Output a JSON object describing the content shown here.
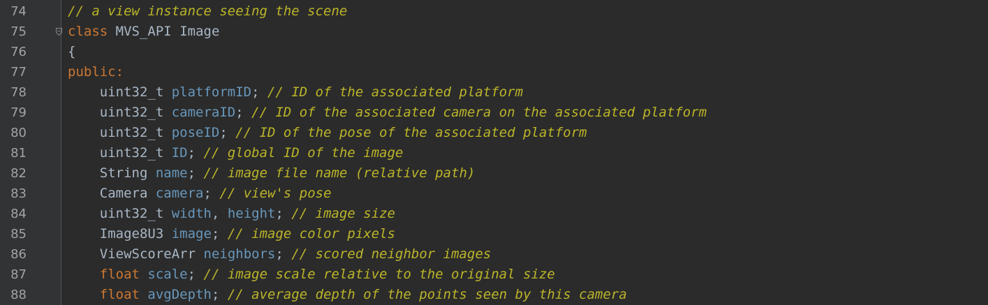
{
  "editor": {
    "lines": [
      {
        "number": "74",
        "indent": "",
        "tokens": [
          {
            "kind": "comment",
            "text": "// a view instance seeing the scene"
          }
        ]
      },
      {
        "number": "75",
        "indent": "",
        "fold": true,
        "tokens": [
          {
            "kind": "kw",
            "text": "class"
          },
          {
            "kind": "plain",
            "text": " "
          },
          {
            "kind": "api",
            "text": "MVS_API"
          },
          {
            "kind": "plain",
            "text": " "
          },
          {
            "kind": "cls",
            "text": "Image"
          }
        ]
      },
      {
        "number": "76",
        "indent": "",
        "tokens": [
          {
            "kind": "plain",
            "text": "{"
          }
        ]
      },
      {
        "number": "77",
        "indent": "",
        "tokens": [
          {
            "kind": "kw",
            "text": "public:"
          }
        ]
      },
      {
        "number": "78",
        "indent": "    ",
        "tokens": [
          {
            "kind": "type",
            "text": "uint32_t"
          },
          {
            "kind": "plain",
            "text": " "
          },
          {
            "kind": "member",
            "text": "platformID"
          },
          {
            "kind": "plain",
            "text": "; "
          },
          {
            "kind": "comment",
            "text": "// ID of the associated platform"
          }
        ]
      },
      {
        "number": "79",
        "indent": "    ",
        "tokens": [
          {
            "kind": "type",
            "text": "uint32_t"
          },
          {
            "kind": "plain",
            "text": " "
          },
          {
            "kind": "member",
            "text": "cameraID"
          },
          {
            "kind": "plain",
            "text": "; "
          },
          {
            "kind": "comment",
            "text": "// ID of the associated camera on the associated platform"
          }
        ]
      },
      {
        "number": "80",
        "indent": "    ",
        "tokens": [
          {
            "kind": "type",
            "text": "uint32_t"
          },
          {
            "kind": "plain",
            "text": " "
          },
          {
            "kind": "member",
            "text": "poseID"
          },
          {
            "kind": "plain",
            "text": "; "
          },
          {
            "kind": "comment",
            "text": "// ID of the pose of the associated platform"
          }
        ]
      },
      {
        "number": "81",
        "indent": "    ",
        "tokens": [
          {
            "kind": "type",
            "text": "uint32_t"
          },
          {
            "kind": "plain",
            "text": " "
          },
          {
            "kind": "member",
            "text": "ID"
          },
          {
            "kind": "plain",
            "text": "; "
          },
          {
            "kind": "comment",
            "text": "// global ID of the image"
          }
        ]
      },
      {
        "number": "82",
        "indent": "    ",
        "tokens": [
          {
            "kind": "type",
            "text": "String"
          },
          {
            "kind": "plain",
            "text": " "
          },
          {
            "kind": "member",
            "text": "name"
          },
          {
            "kind": "plain",
            "text": "; "
          },
          {
            "kind": "comment",
            "text": "// image file name (relative path)"
          }
        ]
      },
      {
        "number": "83",
        "indent": "    ",
        "tokens": [
          {
            "kind": "type",
            "text": "Camera"
          },
          {
            "kind": "plain",
            "text": " "
          },
          {
            "kind": "member",
            "text": "camera"
          },
          {
            "kind": "plain",
            "text": "; "
          },
          {
            "kind": "comment",
            "text": "// view's pose"
          }
        ]
      },
      {
        "number": "84",
        "indent": "    ",
        "tokens": [
          {
            "kind": "type",
            "text": "uint32_t"
          },
          {
            "kind": "plain",
            "text": " "
          },
          {
            "kind": "member",
            "text": "width"
          },
          {
            "kind": "plain",
            "text": ", "
          },
          {
            "kind": "member",
            "text": "height"
          },
          {
            "kind": "plain",
            "text": "; "
          },
          {
            "kind": "comment",
            "text": "// image size"
          }
        ]
      },
      {
        "number": "85",
        "indent": "    ",
        "tokens": [
          {
            "kind": "type",
            "text": "Image8U3"
          },
          {
            "kind": "plain",
            "text": " "
          },
          {
            "kind": "member",
            "text": "image"
          },
          {
            "kind": "plain",
            "text": "; "
          },
          {
            "kind": "comment",
            "text": "// image color pixels"
          }
        ]
      },
      {
        "number": "86",
        "indent": "    ",
        "tokens": [
          {
            "kind": "type",
            "text": "ViewScoreArr"
          },
          {
            "kind": "plain",
            "text": " "
          },
          {
            "kind": "member",
            "text": "neighbors"
          },
          {
            "kind": "plain",
            "text": "; "
          },
          {
            "kind": "comment",
            "text": "// scored neighbor images"
          }
        ]
      },
      {
        "number": "87",
        "indent": "    ",
        "tokens": [
          {
            "kind": "kw",
            "text": "float"
          },
          {
            "kind": "plain",
            "text": " "
          },
          {
            "kind": "member",
            "text": "scale"
          },
          {
            "kind": "plain",
            "text": "; "
          },
          {
            "kind": "comment",
            "text": "// image scale relative to the original size"
          }
        ]
      },
      {
        "number": "88",
        "indent": "    ",
        "tokens": [
          {
            "kind": "kw",
            "text": "float"
          },
          {
            "kind": "plain",
            "text": " "
          },
          {
            "kind": "member",
            "text": "avgDepth"
          },
          {
            "kind": "plain",
            "text": "; "
          },
          {
            "kind": "comment",
            "text": "// average depth of the points seen by this camera"
          }
        ]
      }
    ]
  },
  "colors": {
    "background": "#2b2b2b",
    "gutter": "#313335",
    "line_number": "#a4a3a3",
    "keyword": "#cc7832",
    "identifier": "#a9b7c6",
    "member": "#6897bb",
    "comment": "#bbb529"
  },
  "icons": {
    "fold": "fold-marker-icon"
  }
}
